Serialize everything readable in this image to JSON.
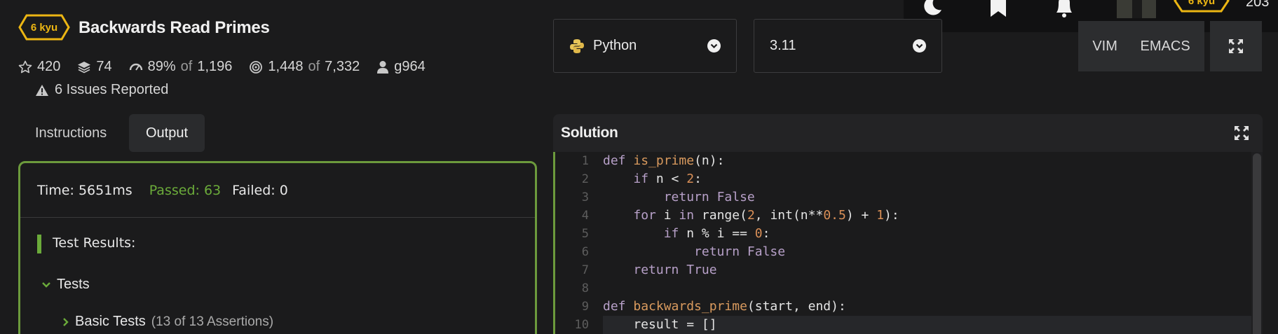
{
  "kata": {
    "rank": "6 kyu",
    "title": "Backwards Read Primes",
    "stars": "420",
    "collections": "74",
    "satisfaction": "89%",
    "of_word": "of",
    "votes": "1,196",
    "completions": "1,448",
    "attempts": "7,332",
    "author": "g964",
    "issues": "6 Issues Reported"
  },
  "tabs": {
    "instructions": "Instructions",
    "output": "Output"
  },
  "output": {
    "time": "Time: 5651ms",
    "passed": "Passed: 63",
    "failed": "Failed: 0",
    "test_results_label": "Test Results:",
    "tests_label": "Tests",
    "basic_tests_label": "Basic Tests",
    "basic_tests_count": "(13 of 13 Assertions)"
  },
  "language": {
    "selected": "Python",
    "icon": "python-icon"
  },
  "version": {
    "selected": "3.11"
  },
  "editor_modes": {
    "vim": "VIM",
    "emacs": "EMACS"
  },
  "user": {
    "rank": "6 kyu",
    "honor": "203"
  },
  "solution": {
    "title": "Solution",
    "line_numbers": [
      "1",
      "2",
      "3",
      "4",
      "5",
      "6",
      "7",
      "8",
      "9",
      "10"
    ]
  },
  "colors": {
    "accent_green": "#6c9a3c",
    "kyu_yellow": "#ecb613",
    "passed_green": "#6bab3a"
  }
}
